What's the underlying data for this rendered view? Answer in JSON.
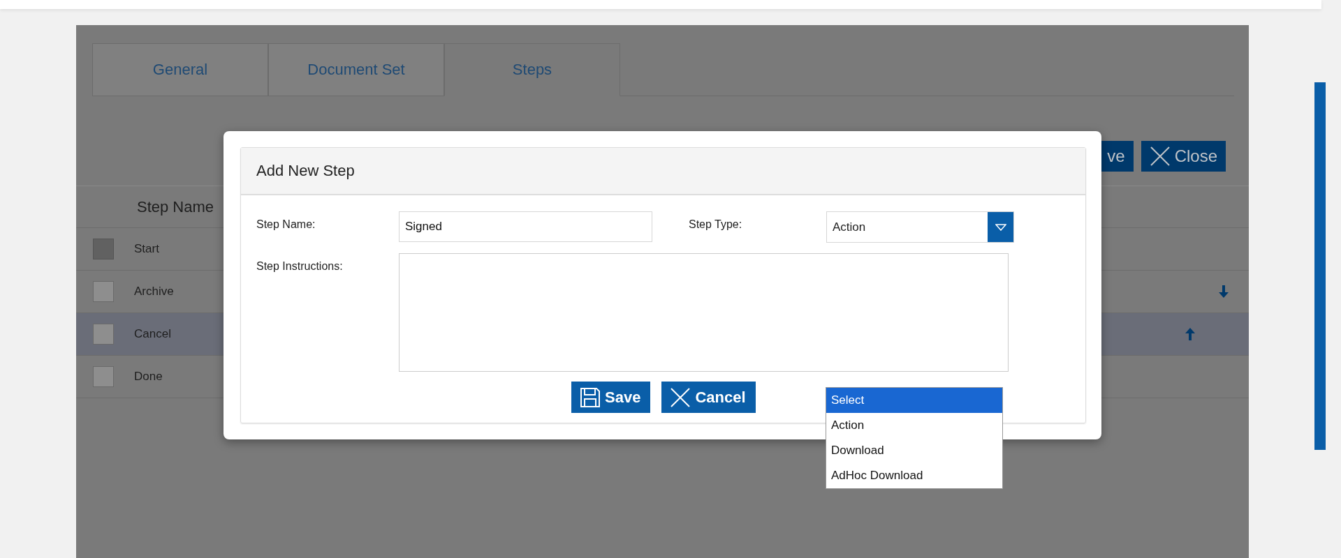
{
  "tabs": [
    {
      "label": "General",
      "selected": false
    },
    {
      "label": "Document Set",
      "selected": false
    },
    {
      "label": "Steps",
      "selected": true
    }
  ],
  "toolbar_buttons": [
    {
      "label": "ve",
      "kind": "partial"
    },
    {
      "label": "Close",
      "kind": "close"
    }
  ],
  "table": {
    "columns": [
      "Step Name"
    ],
    "rows": [
      {
        "name": "Start",
        "selected": false,
        "disabled": true,
        "kind": "plain"
      },
      {
        "name": "Archive",
        "selected": false,
        "disabled": false,
        "kind": "down"
      },
      {
        "name": "Cancel",
        "selected": true,
        "disabled": false,
        "kind": "up"
      },
      {
        "name": "Done",
        "selected": false,
        "disabled": false,
        "kind": "plain"
      }
    ]
  },
  "dialog": {
    "title": "Add New Step",
    "step_name": {
      "label": "Step Name:",
      "value": "Signed"
    },
    "step_type": {
      "label": "Step Type:",
      "value": "Action",
      "expanded": true,
      "options": [
        {
          "label": "Select",
          "highlighted": true
        },
        {
          "label": "Action",
          "highlighted": false
        },
        {
          "label": "Download",
          "highlighted": false
        },
        {
          "label": "AdHoc Download",
          "highlighted": false
        }
      ]
    },
    "step_instructions": {
      "label": "Step Instructions:"
    },
    "buttons": [
      {
        "label": "Save",
        "kind": "save"
      },
      {
        "label": "Cancel",
        "kind": "close"
      }
    ]
  }
}
